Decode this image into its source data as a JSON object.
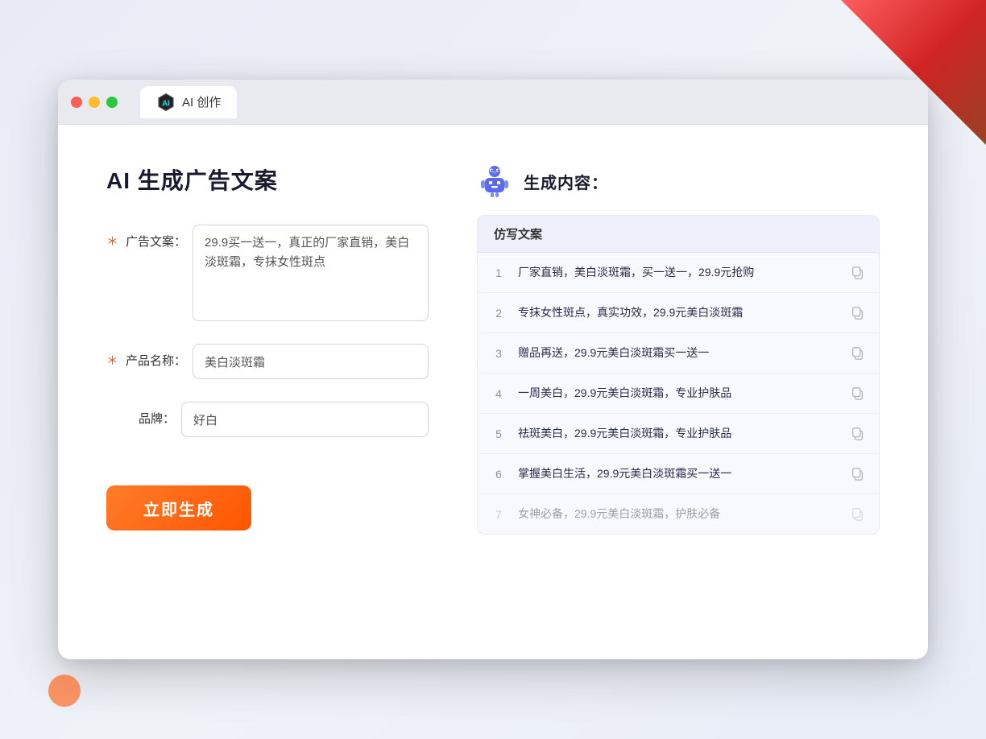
{
  "browser": {
    "tab_title": "AI 创作",
    "traffic_lights": [
      "red",
      "yellow",
      "green"
    ]
  },
  "left_panel": {
    "page_title": "AI 生成广告文案",
    "form": {
      "ad_copy_label": "广告文案：",
      "ad_copy_required": "＊",
      "ad_copy_value": "29.9买一送一，真正的厂家直销，美白淡斑霜，专抹女性斑点",
      "product_name_label": "产品名称：",
      "product_name_required": "＊",
      "product_name_value": "美白淡斑霜",
      "brand_label": "品牌：",
      "brand_value": "好白",
      "submit_label": "立即生成"
    }
  },
  "right_panel": {
    "title": "生成内容：",
    "table_header": "仿写文案",
    "results": [
      {
        "num": "1",
        "text": "厂家直销，美白淡斑霜，买一送一，29.9元抢购",
        "dimmed": false
      },
      {
        "num": "2",
        "text": "专抹女性斑点，真实功效，29.9元美白淡斑霜",
        "dimmed": false
      },
      {
        "num": "3",
        "text": "赠品再送，29.9元美白淡斑霜买一送一",
        "dimmed": false
      },
      {
        "num": "4",
        "text": "一周美白，29.9元美白淡斑霜，专业护肤品",
        "dimmed": false
      },
      {
        "num": "5",
        "text": "祛斑美白，29.9元美白淡斑霜，专业护肤品",
        "dimmed": false
      },
      {
        "num": "6",
        "text": "掌握美白生活，29.9元美白淡斑霜买一送一",
        "dimmed": false
      },
      {
        "num": "7",
        "text": "女神必备，29.9元美白淡斑霜，护肤必备",
        "dimmed": true
      }
    ]
  }
}
